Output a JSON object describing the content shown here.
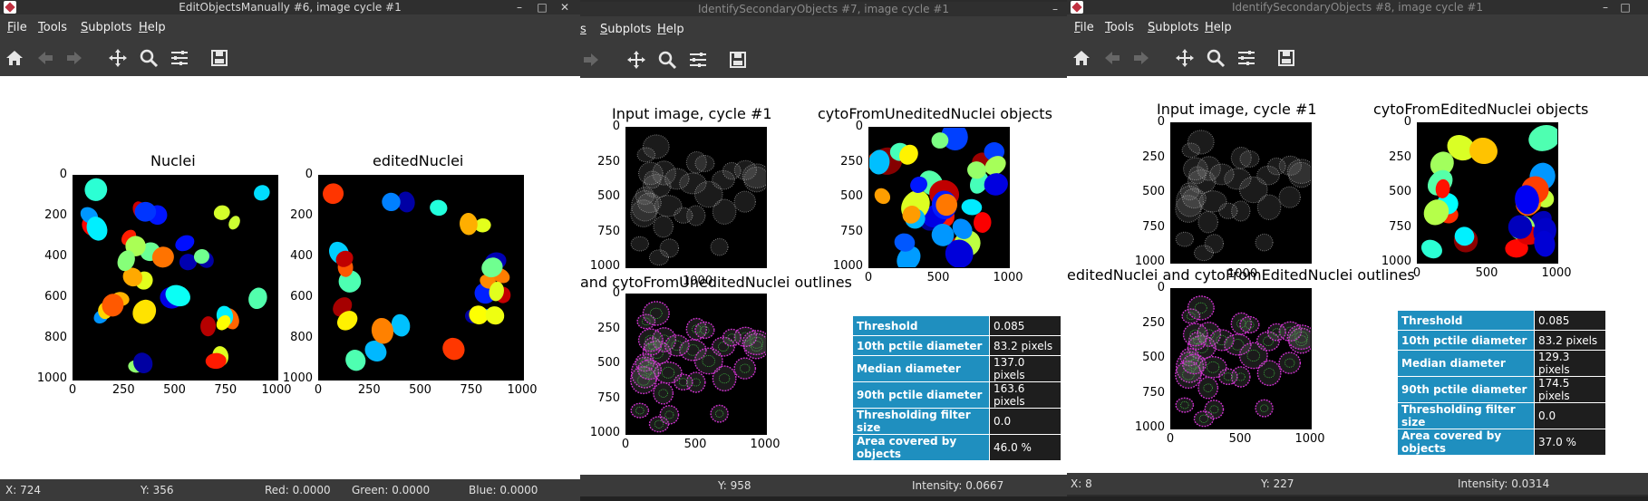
{
  "windows": [
    {
      "title": "EditObjectsManually #6, image cycle #1",
      "menus": [
        "File",
        "Tools",
        "Subplots",
        "Help"
      ],
      "plots": [
        {
          "title": "Nuclei"
        },
        {
          "title": "editedNuclei"
        }
      ],
      "status": {
        "x": "X: 724",
        "y": "Y: 356",
        "red": "Red: 0.0000",
        "green": "Green: 0.0000",
        "blue": "Blue: 0.0000"
      }
    },
    {
      "title": "IdentifySecondaryObjects #7, image cycle #1",
      "menus": [
        "Subplots",
        "Help"
      ],
      "plots": [
        {
          "title": "Input image, cycle #1"
        },
        {
          "title": "cytoFromUneditedNuclei objects"
        },
        {
          "title": "and cytoFromUneditedNuclei outlines"
        }
      ],
      "overlap_tick": "1000",
      "table": [
        {
          "label": "Threshold",
          "value": "0.085"
        },
        {
          "label": "10th pctile diameter",
          "value": "83.2 pixels"
        },
        {
          "label": "Median diameter",
          "value": "137.0 pixels"
        },
        {
          "label": "90th pctile diameter",
          "value": "163.6 pixels"
        },
        {
          "label": "Thresholding filter size",
          "value": "0.0"
        },
        {
          "label": "Area covered by objects",
          "value": "46.0 %"
        }
      ],
      "status": {
        "y": "Y: 958",
        "intensity": "Intensity: 0.0667"
      }
    },
    {
      "title": "IdentifySecondaryObjects #8, image cycle #1",
      "menus": [
        "File",
        "Tools",
        "Subplots",
        "Help"
      ],
      "plots": [
        {
          "title": "Input image, cycle #1"
        },
        {
          "title": "cytoFromEditedNuclei objects"
        },
        {
          "title": "editedNuclei and cytoFromEditedNuclei outlines"
        }
      ],
      "overlap_tick": "1000",
      "table": [
        {
          "label": "Threshold",
          "value": "0.085"
        },
        {
          "label": "10th pctile diameter",
          "value": "83.2 pixels"
        },
        {
          "label": "Median diameter",
          "value": "129.3 pixels"
        },
        {
          "label": "90th pctile diameter",
          "value": "174.5 pixels"
        },
        {
          "label": "Thresholding filter size",
          "value": "0.0"
        },
        {
          "label": "Area covered by objects",
          "value": "37.0 %"
        }
      ],
      "status": {
        "x": "X: 8",
        "y": "Y: 227",
        "intensity": "Intensity: 0.0314"
      }
    }
  ],
  "ticks": {
    "y_nuclei": [
      "0",
      "200",
      "400",
      "600",
      "800",
      "1000"
    ],
    "x_nuclei": [
      "0",
      "250",
      "500",
      "750",
      "1000"
    ],
    "y_cyto": [
      "0",
      "250",
      "500",
      "750",
      "1000"
    ],
    "x_cyto": [
      "0",
      "500",
      "1000"
    ]
  },
  "window_controls": {
    "minimize": "–",
    "maximize": "□",
    "close": "✕"
  },
  "toolbar_icons": [
    "home-icon",
    "back-arrow-icon",
    "forward-arrow-icon",
    "pan-icon",
    "zoom-icon",
    "configure-subplots-icon",
    "save-icon"
  ],
  "colors": {
    "table_label_bg": "#1f8fbf",
    "table_value_bg": "#1e1e1e",
    "outline_magenta": "#d030d0",
    "outline_green": "#40c040"
  }
}
